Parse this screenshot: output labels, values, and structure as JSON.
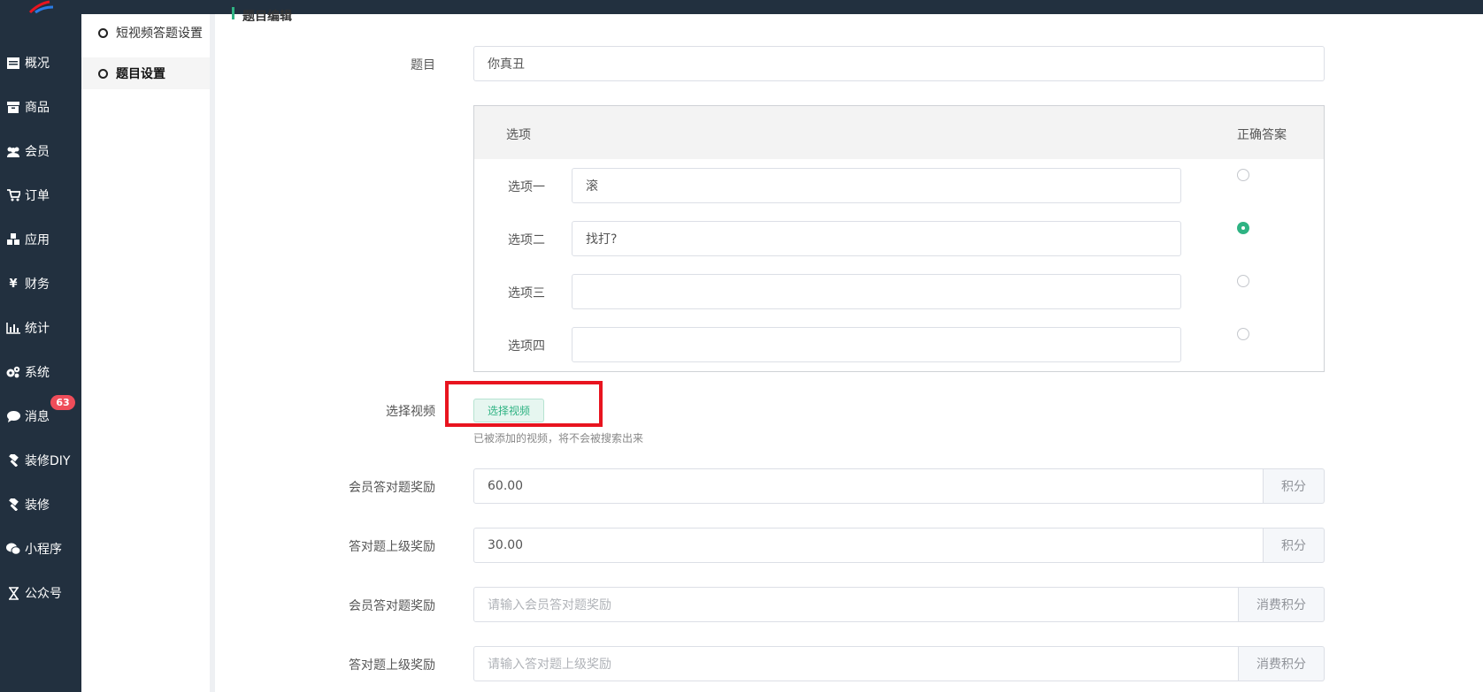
{
  "sidebar": {
    "items": [
      {
        "label": "概况",
        "icon": "dashboard-icon"
      },
      {
        "label": "商品",
        "icon": "archive-icon"
      },
      {
        "label": "会员",
        "icon": "users-icon"
      },
      {
        "label": "订单",
        "icon": "cart-icon"
      },
      {
        "label": "应用",
        "icon": "cubes-icon"
      },
      {
        "label": "财务",
        "icon": "yen-icon"
      },
      {
        "label": "统计",
        "icon": "bar-chart-icon"
      },
      {
        "label": "系统",
        "icon": "gears-icon"
      },
      {
        "label": "消息",
        "icon": "comment-icon"
      },
      {
        "label": "装修DIY",
        "icon": "hammer-icon"
      },
      {
        "label": "装修",
        "icon": "hammer-icon"
      },
      {
        "label": "小程序",
        "icon": "wechat-icon"
      },
      {
        "label": "公众号",
        "icon": "hourglass-icon"
      }
    ],
    "message_badge": "63"
  },
  "subnav": {
    "items": [
      {
        "label": "短视频答题设置"
      },
      {
        "label": "题目设置"
      }
    ]
  },
  "section_title": "题目编辑",
  "form": {
    "question_label": "题目",
    "question_value": "你真丑",
    "options_header": "选项",
    "correct_header": "正确答案",
    "options": [
      {
        "label": "选项一",
        "value": "滚",
        "correct": false
      },
      {
        "label": "选项二",
        "value": "找打?",
        "correct": true
      },
      {
        "label": "选项三",
        "value": "",
        "correct": false
      },
      {
        "label": "选项四",
        "value": "",
        "correct": false
      }
    ],
    "video_label": "选择视频",
    "video_button": "选择视频",
    "video_hint": "已被添加的视频，将不会被搜索出来",
    "reward_rows": [
      {
        "label": "会员答对题奖励",
        "value": "60.00",
        "placeholder": "",
        "addon": "积分"
      },
      {
        "label": "答对题上级奖励",
        "value": "30.00",
        "placeholder": "",
        "addon": "积分"
      },
      {
        "label": "会员答对题奖励",
        "value": "",
        "placeholder": "请输入会员答对题奖励",
        "addon": "消费积分"
      },
      {
        "label": "答对题上级奖励",
        "value": "",
        "placeholder": "请输入答对题上级奖励",
        "addon": "消费积分"
      }
    ]
  },
  "colors": {
    "sidebar_bg": "#22303f",
    "accent": "#2fb383",
    "badge": "#ef4d5a",
    "highlight": "#e8141f"
  }
}
